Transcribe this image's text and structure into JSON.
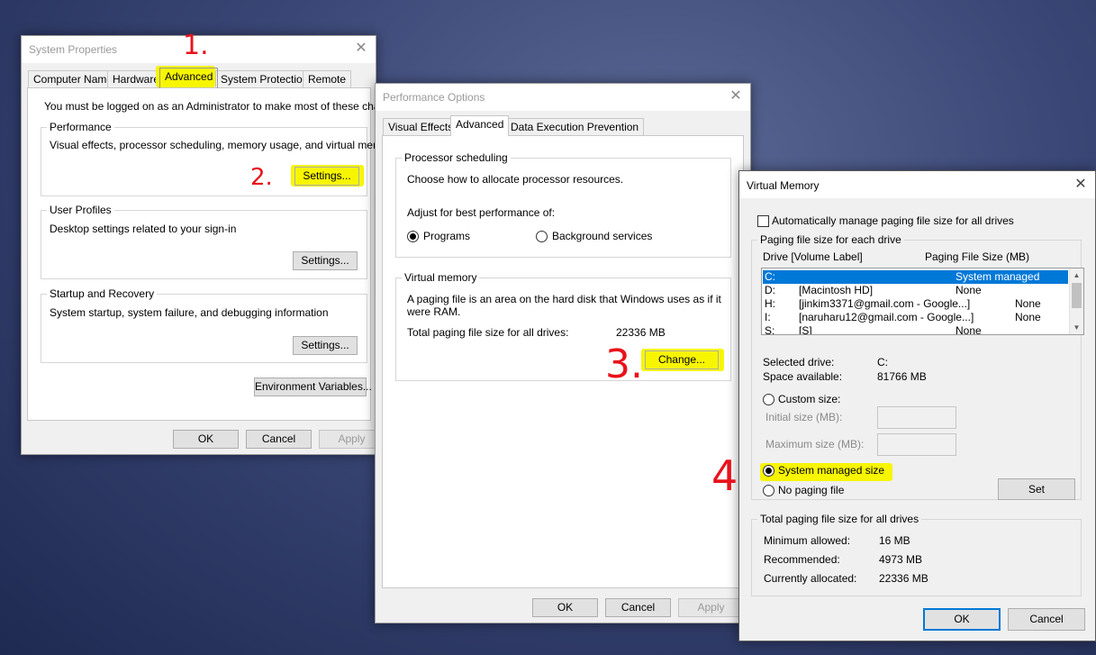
{
  "system_properties": {
    "title": "System Properties",
    "close_glyph": "✕",
    "tabs": [
      "Computer Name",
      "Hardware",
      "Advanced",
      "System Protection",
      "Remote"
    ],
    "admin_note": "You must be logged on as an Administrator to make most of these changes.",
    "performance": {
      "label": "Performance",
      "desc": "Visual effects, processor scheduling, memory usage, and virtual memory",
      "button": "Settings..."
    },
    "user_profiles": {
      "label": "User Profiles",
      "desc": "Desktop settings related to your sign-in",
      "button": "Settings..."
    },
    "startup": {
      "label": "Startup and Recovery",
      "desc": "System startup, system failure, and debugging information",
      "button": "Settings..."
    },
    "env_button": "Environment Variables...",
    "ok": "OK",
    "cancel": "Cancel",
    "apply": "Apply"
  },
  "performance_options": {
    "title": "Performance Options",
    "close_glyph": "✕",
    "tabs": [
      "Visual Effects",
      "Advanced",
      "Data Execution Prevention"
    ],
    "processor": {
      "label": "Processor scheduling",
      "desc": "Choose how to allocate processor resources.",
      "adjust": "Adjust for best performance of:",
      "programs": "Programs",
      "background": "Background services"
    },
    "vmem": {
      "label": "Virtual memory",
      "desc_line1": "A paging file is an area on the hard disk that Windows uses as if it",
      "desc_line2": "were RAM.",
      "total_label": "Total paging file size for all drives:",
      "total_value": "22336 MB",
      "change": "Change..."
    },
    "ok": "OK",
    "cancel": "Cancel",
    "apply": "Apply"
  },
  "virtual_memory": {
    "title": "Virtual Memory",
    "close_glyph": "✕",
    "auto_manage": "Automatically manage paging file size for all drives",
    "group_label": "Paging file size for each drive",
    "col_drive": "Drive  [Volume Label]",
    "col_size": "Paging File Size (MB)",
    "drives": [
      {
        "drive": "C:",
        "label": "",
        "size": "System managed"
      },
      {
        "drive": "D:",
        "label": "[Macintosh HD]",
        "size": "None"
      },
      {
        "drive": "H:",
        "label": "[jinkim3371@gmail.com - Google...]",
        "size": "None"
      },
      {
        "drive": "I:",
        "label": "[naruharu12@gmail.com - Google...]",
        "size": "None"
      },
      {
        "drive": "S:",
        "label": "[S]",
        "size": "None"
      }
    ],
    "selected_drive_label": "Selected drive:",
    "selected_drive_value": "C:",
    "space_label": "Space available:",
    "space_value": "81766 MB",
    "custom_size": "Custom size:",
    "initial_size": "Initial size (MB):",
    "maximum_size": "Maximum size (MB):",
    "system_managed": "System managed size",
    "no_paging": "No paging file",
    "set": "Set",
    "total_group": "Total paging file size for all drives",
    "min_label": "Minimum allowed:",
    "min_value": "16 MB",
    "rec_label": "Recommended:",
    "rec_value": "4973 MB",
    "cur_label": "Currently allocated:",
    "cur_value": "22336 MB",
    "ok": "OK",
    "cancel": "Cancel"
  },
  "annotations": {
    "step1": "1.",
    "step2": "2.",
    "step3": "3.",
    "step4": "4"
  },
  "colors": {
    "highlight": "#f7f500",
    "annotation": "#e8121b",
    "selection": "#0078d7"
  }
}
